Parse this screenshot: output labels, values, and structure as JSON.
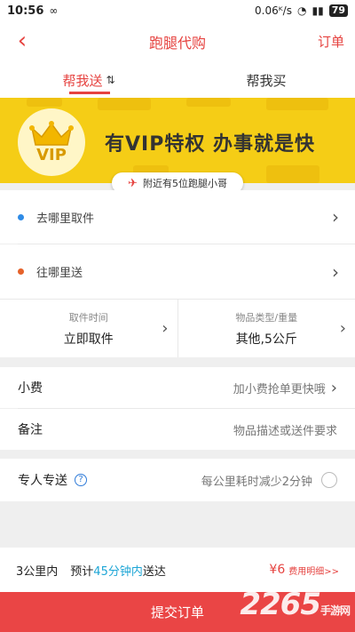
{
  "status_bar": {
    "time": "10:56",
    "speed": "0.06ᴷ/s",
    "battery": "79"
  },
  "nav": {
    "title": "跑腿代购",
    "right_link": "订单"
  },
  "tabs": [
    {
      "label": "帮我送",
      "active": true
    },
    {
      "label": "帮我买",
      "active": false
    }
  ],
  "banner": {
    "vip_label": "VIP",
    "slogan": "有VIP特权  办事就是快",
    "nearby_runners": "附近有5位跑腿小哥"
  },
  "pickup": {
    "label": "去哪里取件",
    "dot_color": "#2f8be6"
  },
  "dropoff": {
    "label": "往哪里送",
    "dot_color": "#e5622a"
  },
  "pickup_time": {
    "label": "取件时间",
    "value": "立即取件"
  },
  "item_type": {
    "label": "物品类型/重量",
    "value": "其他,5公斤"
  },
  "tip": {
    "label": "小费",
    "hint": "加小费抢单更快哦"
  },
  "note": {
    "label": "备注",
    "placeholder": "物品描述或送件要求"
  },
  "dedicated": {
    "label": "专人专送",
    "hint": "每公里耗时减少2分钟"
  },
  "summary": {
    "distance": "3公里内",
    "eta_prefix": "预计",
    "eta": "45分钟内",
    "eta_suffix": "送达",
    "price": "¥6",
    "fee_detail": "费用明细>>"
  },
  "submit_label": "提交订单",
  "watermark": {
    "brand": "2265",
    "suffix": "手游网"
  }
}
